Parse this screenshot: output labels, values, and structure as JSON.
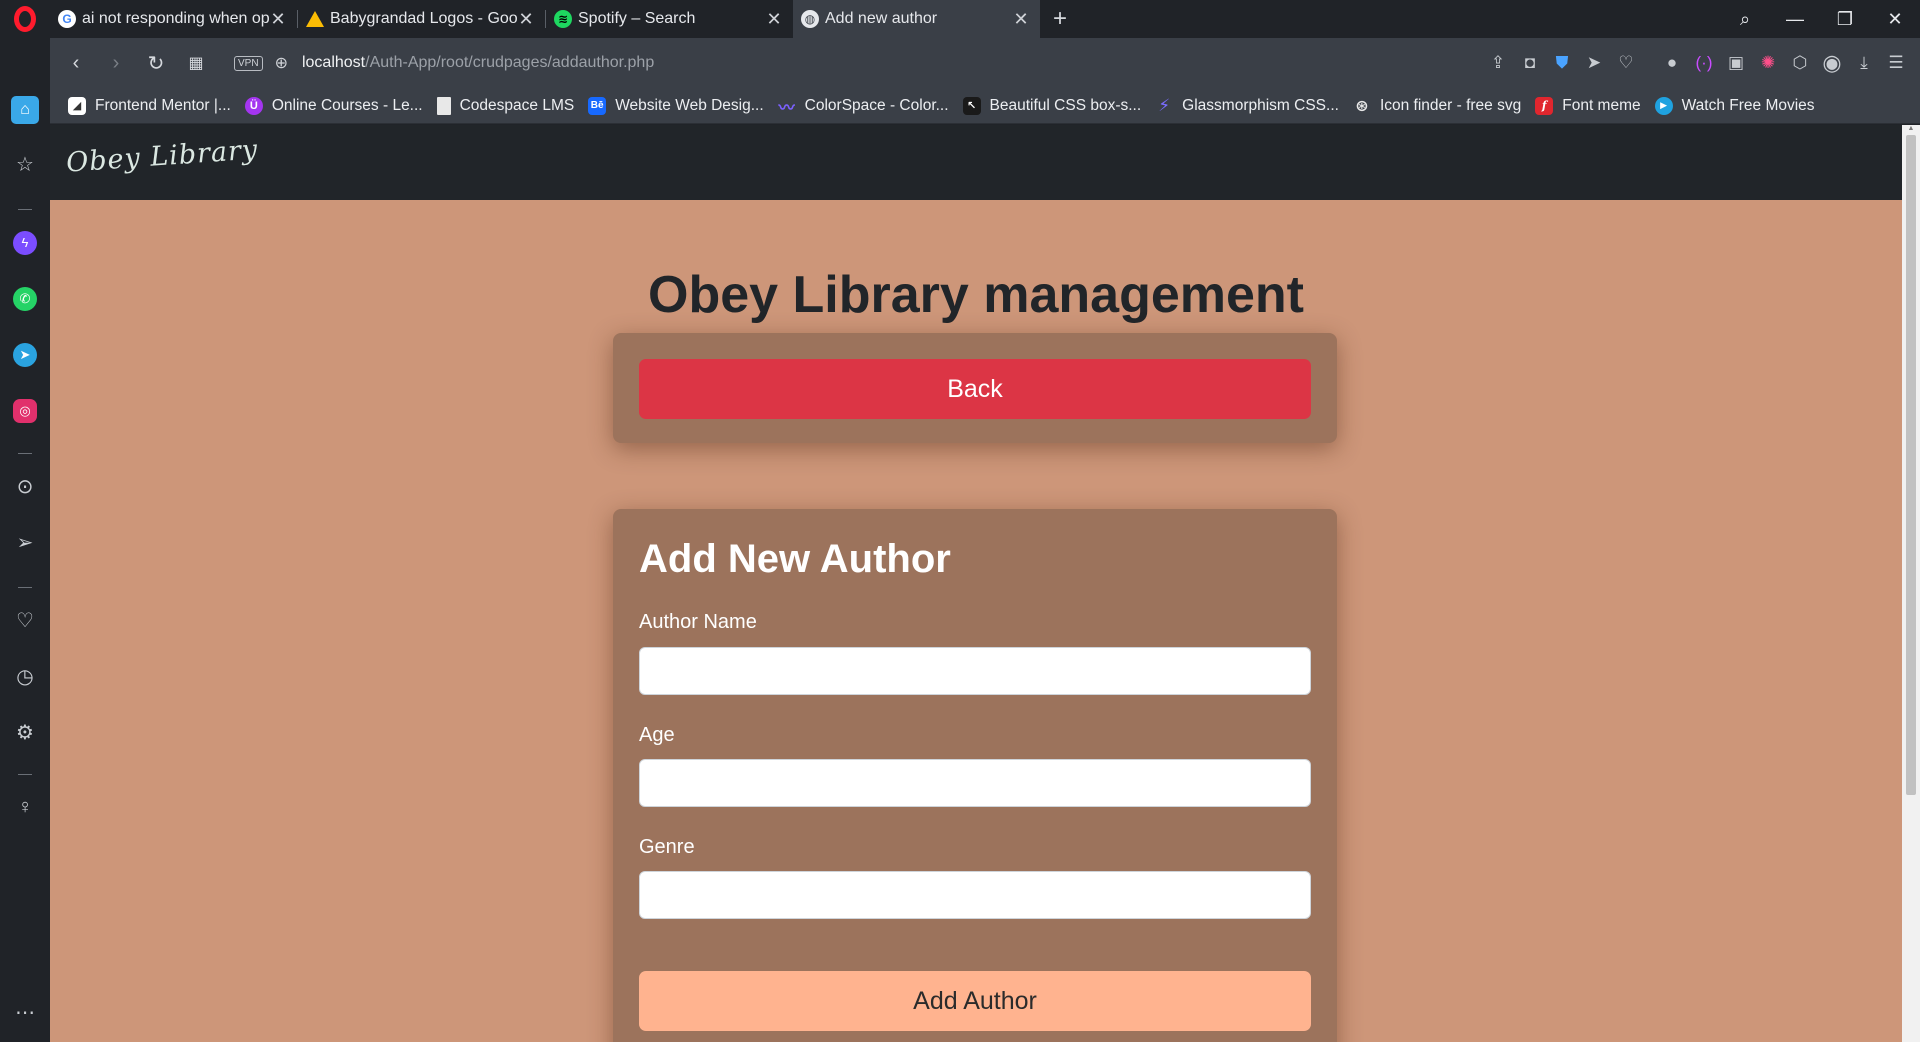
{
  "browser": {
    "tabs": [
      {
        "title": "ai not responding when op",
        "favicon": "google-icon",
        "active": false
      },
      {
        "title": "Babygrandad Logos - Goog",
        "favicon": "google-drive-icon",
        "active": false
      },
      {
        "title": "Spotify – Search",
        "favicon": "spotify-icon",
        "active": false
      },
      {
        "title": "Add new author",
        "favicon": "globe-icon",
        "active": true
      }
    ],
    "new_tab_symbol": "+",
    "address": {
      "vpn_label": "VPN",
      "host": "localhost",
      "path": "/Auth-App/root/crudpages/addauthor.php"
    },
    "bookmarks": [
      {
        "label": "Frontend Mentor |...",
        "icon": "frontend-mentor-icon",
        "color": "#ffffff"
      },
      {
        "label": "Online Courses - Le...",
        "icon": "udemy-icon",
        "color": "#a435f0"
      },
      {
        "label": "Codespace LMS",
        "icon": "document-icon",
        "color": "#e8e8e8"
      },
      {
        "label": "Website Web Desig...",
        "icon": "behance-icon",
        "color": "#1769ff"
      },
      {
        "label": "ColorSpace - Color...",
        "icon": "colorspace-icon",
        "color": "#7b61ff"
      },
      {
        "label": "Beautiful CSS box-s...",
        "icon": "cursor-icon",
        "color": "#1a1a1a"
      },
      {
        "label": "Glassmorphism CSS...",
        "icon": "glassmorphism-icon",
        "color": "#6a5cff"
      },
      {
        "label": "Icon finder - free svg",
        "icon": "iconfinder-icon",
        "color": "#e8e8e8"
      },
      {
        "label": "Font meme",
        "icon": "fontmeme-icon",
        "color": "#e0262e"
      },
      {
        "label": "Watch Free Movies",
        "icon": "play-icon",
        "color": "#1fa2e0"
      }
    ]
  },
  "site": {
    "brand": "Obey Library",
    "page_title": "Obey Library management",
    "back_label": "Back",
    "form": {
      "title": "Add New Author",
      "fields": [
        {
          "label": "Author Name",
          "value": "",
          "placeholder": ""
        },
        {
          "label": "Age",
          "value": "",
          "placeholder": ""
        },
        {
          "label": "Genre",
          "value": "",
          "placeholder": ""
        }
      ],
      "submit_label": "Add Author"
    }
  },
  "colors": {
    "page_background": "#cd9679",
    "card_background": "#9c735c",
    "navbar": "#212529",
    "back_button": "#dc3545",
    "submit_button": "#ffb38f"
  }
}
